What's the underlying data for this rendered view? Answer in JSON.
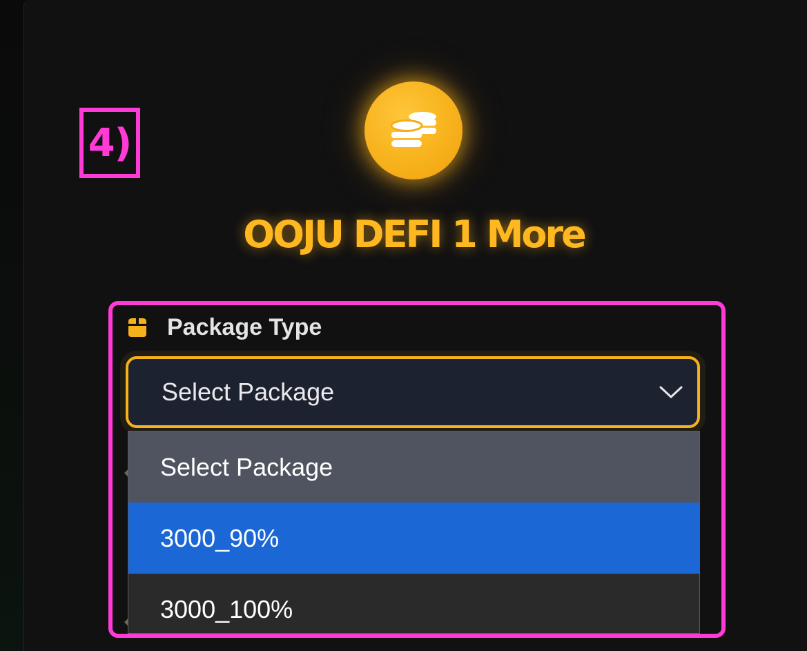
{
  "step_label": "4)",
  "title": "OOJU DEFI 1 More",
  "icons": {
    "badge": "coins-icon",
    "field": "package-icon",
    "select": "chevron-down-icon"
  },
  "colors": {
    "accent": "#f5b21a",
    "annotation": "#ff3ad7",
    "option_selected_bg": "#1a67d5",
    "option_hover_bg": "#505460",
    "panel_bg": "#111112"
  },
  "package_field": {
    "label": "Package Type",
    "selected_value": "Select Package",
    "options": [
      {
        "label": "Select Package",
        "state": "hover"
      },
      {
        "label": "3000_90%",
        "state": "highlighted"
      },
      {
        "label": "3000_100%",
        "state": "normal"
      }
    ]
  }
}
